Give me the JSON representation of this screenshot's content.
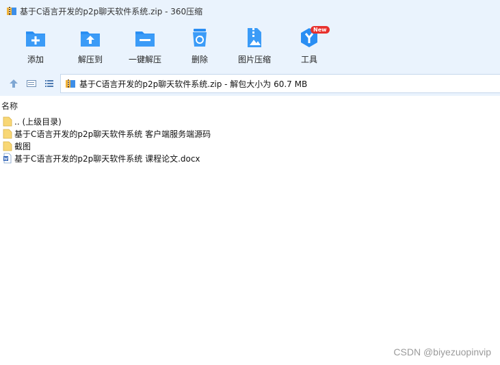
{
  "window": {
    "title": "基于C语言开发的p2p聊天软件系统.zip - 360压缩",
    "app_icon": "zip-archive-icon"
  },
  "toolbar": {
    "buttons": [
      {
        "label": "添加",
        "icon": "add-folder-icon"
      },
      {
        "label": "解压到",
        "icon": "extract-to-icon"
      },
      {
        "label": "一键解压",
        "icon": "one-click-extract-icon"
      },
      {
        "label": "删除",
        "icon": "recycle-bin-icon"
      },
      {
        "label": "图片压缩",
        "icon": "image-compress-icon"
      },
      {
        "label": "工具",
        "icon": "tools-icon",
        "badge": "New"
      }
    ]
  },
  "addressbar": {
    "path": "基于C语言开发的p2p聊天软件系统.zip - 解包大小为 60.7 MB",
    "nav": [
      "up-arrow-icon",
      "details-view-icon",
      "list-view-icon"
    ]
  },
  "filelist": {
    "column_header": "名称",
    "items": [
      {
        "name": ".. (上级目录)",
        "type": "folder"
      },
      {
        "name": "基于C语言开发的p2p聊天软件系统 客户端服务端源码",
        "type": "folder"
      },
      {
        "name": "截图",
        "type": "folder"
      },
      {
        "name": "基于C语言开发的p2p聊天软件系统 课程论文.docx",
        "type": "word-document"
      }
    ]
  },
  "watermark": "CSDN @biyezuopinvip",
  "colors": {
    "toolbar_bg": "#eaf3fd",
    "icon_blue": "#2a8ef3",
    "badge_red": "#e8312d",
    "folder_yellow": "#f8d775"
  }
}
